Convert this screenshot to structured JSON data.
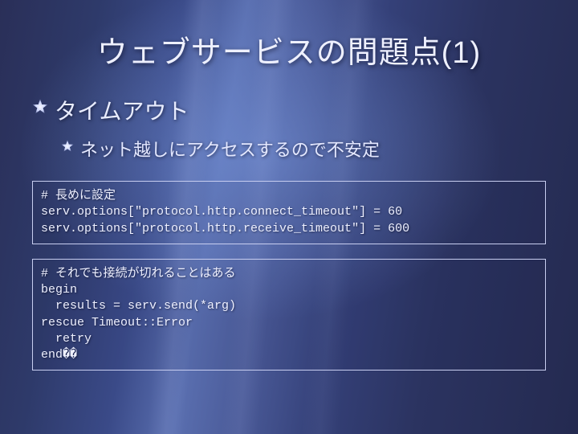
{
  "title": "ウェブサービスの問題点(1)",
  "bullets": {
    "b1": "タイムアウト",
    "b2": "ネット越しにアクセスするので不安定"
  },
  "code1": "# 長めに設定\nserv.options[\"protocol.http.connect_timeout\"] = 60\nserv.options[\"protocol.http.receive_timeout\"] = 600",
  "code2": "# それでも接続が切れることはある\nbegin\n  results = serv.send(*arg)\nrescue Timeout::Error\n  retry\nend��"
}
